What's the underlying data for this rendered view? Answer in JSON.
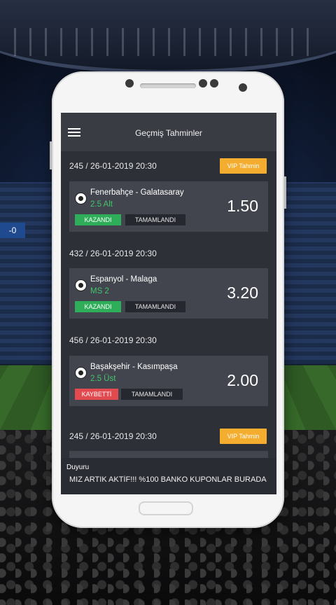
{
  "background": {
    "scoreboard": "-0"
  },
  "app": {
    "title": "Geçmiş Tahminler"
  },
  "predictions": [
    {
      "header": "245 / 26-01-2019 20:30",
      "vip": "VIP Tahmin",
      "match": "Fenerbahçe - Galatasaray",
      "pick": "2.5 Alt",
      "odds": "1.50",
      "result": "KAZANDI",
      "status": "TAMAMLANDI"
    },
    {
      "header": "432 / 26-01-2019 20:30",
      "vip": "",
      "match": "Espanyol - Malaga",
      "pick": "MS 2",
      "odds": "3.20",
      "result": "KAZANDI",
      "status": "TAMAMLANDI"
    },
    {
      "header": "456 / 26-01-2019 20:30",
      "vip": "",
      "match": "Başakşehir - Kasımpaşa",
      "pick": "2.5 Üst",
      "odds": "2.00",
      "result": "KAYBETTİ",
      "status": "TAMAMLANDI"
    },
    {
      "header": "245 / 26-01-2019 20:30",
      "vip": "VIP Tahmin"
    }
  ],
  "announcement": {
    "label": "Duyuru",
    "text": "MIZ ARTIK AKTİF!!! %100 BANKO KUPONLAR BURADA"
  },
  "colors": {
    "vip": "#f4ad2e",
    "win": "#2fae5a",
    "lose": "#e24a4f",
    "pick": "#45c46b"
  }
}
